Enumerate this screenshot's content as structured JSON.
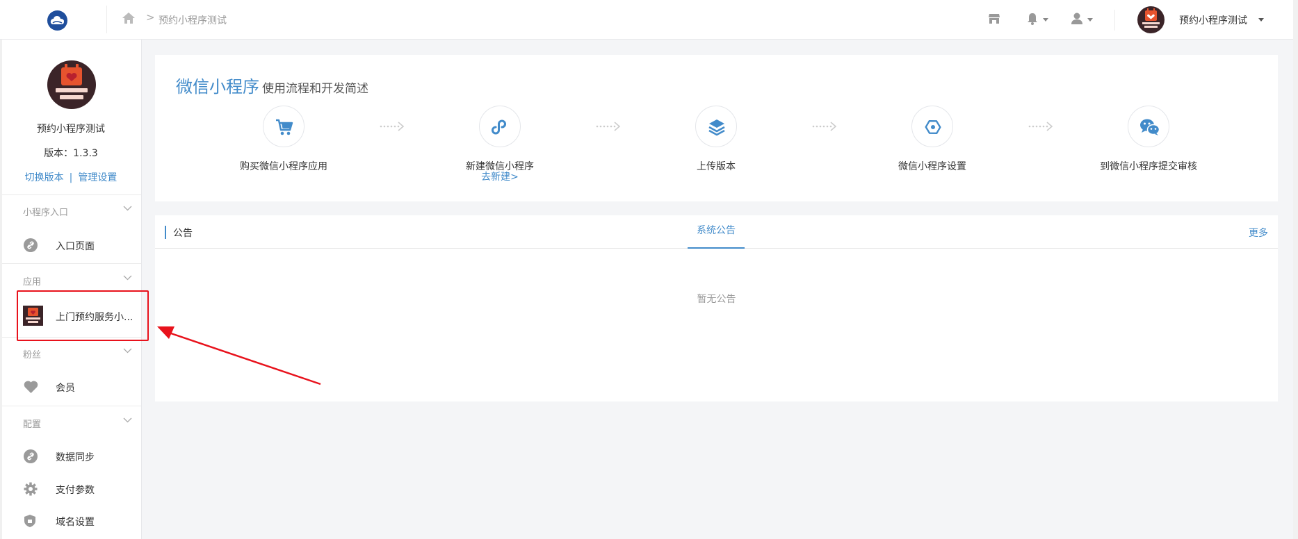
{
  "header": {
    "breadcrumb_current": "预约小程序测试",
    "breadcrumb_separator": ">",
    "account_name": "预约小程序测试"
  },
  "sidebar": {
    "app_name": "预约小程序测试",
    "version": "版本：1.3.3",
    "switch_version_link": "切换版本",
    "link_separator": "|",
    "manage_settings_link": "管理设置",
    "sections": [
      {
        "title": "小程序入口",
        "items": [
          {
            "label": "入口页面",
            "icon": "link-icon"
          }
        ]
      },
      {
        "title": "应用",
        "items": [
          {
            "label": "上门预约服务小...",
            "icon": "app-thumbnail"
          }
        ]
      },
      {
        "title": "粉丝",
        "items": [
          {
            "label": "会员",
            "icon": "heart-icon"
          }
        ]
      },
      {
        "title": "配置",
        "items": [
          {
            "label": "数据同步",
            "icon": "link-icon"
          },
          {
            "label": "支付参数",
            "icon": "gear-icon"
          },
          {
            "label": "域名设置",
            "icon": "shield-icon"
          }
        ]
      }
    ]
  },
  "flow": {
    "title_main": "微信小程序",
    "title_sub": "使用流程和开发简述",
    "steps": [
      {
        "label": "购买微信小程序应用",
        "icon": "cart-icon"
      },
      {
        "label": "新建微信小程序",
        "link": "去新建>",
        "icon": "mini-program-icon"
      },
      {
        "label": "上传版本",
        "icon": "layers-icon"
      },
      {
        "label": "微信小程序设置",
        "icon": "hexagon-icon"
      },
      {
        "label": "到微信小程序提交审核",
        "icon": "wechat-icon"
      }
    ]
  },
  "notice": {
    "title": "公告",
    "tab": "系统公告",
    "more": "更多",
    "empty_text": "暂无公告"
  },
  "colors": {
    "accent": "#428bca",
    "highlight": "#e8121c"
  }
}
